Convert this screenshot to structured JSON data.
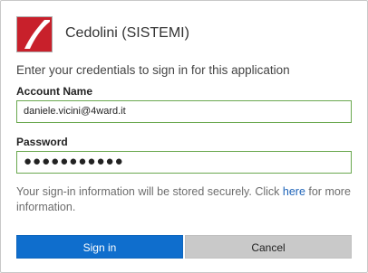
{
  "app": {
    "title": "Cedolini (SISTEMI)",
    "logo_icon": "app-logo-icon",
    "logo_colors": {
      "red": "#c8202b",
      "white": "#ffffff"
    }
  },
  "form": {
    "subtitle": "Enter your credentials to sign in for this application",
    "account_label": "Account Name",
    "account_value": "daniele.vicini@4ward.it",
    "password_label": "Password",
    "password_value": "●●●●●●●●●●●",
    "info_prefix": "Your sign-in information will be stored securely. Click ",
    "info_link": "here",
    "info_suffix": " for more information."
  },
  "buttons": {
    "sign_in": "Sign in",
    "cancel": "Cancel"
  },
  "colors": {
    "primary": "#0f6ecd",
    "input_border": "#6aa84f",
    "link": "#1d63b8",
    "cancel_bg": "#c9c9c9"
  }
}
